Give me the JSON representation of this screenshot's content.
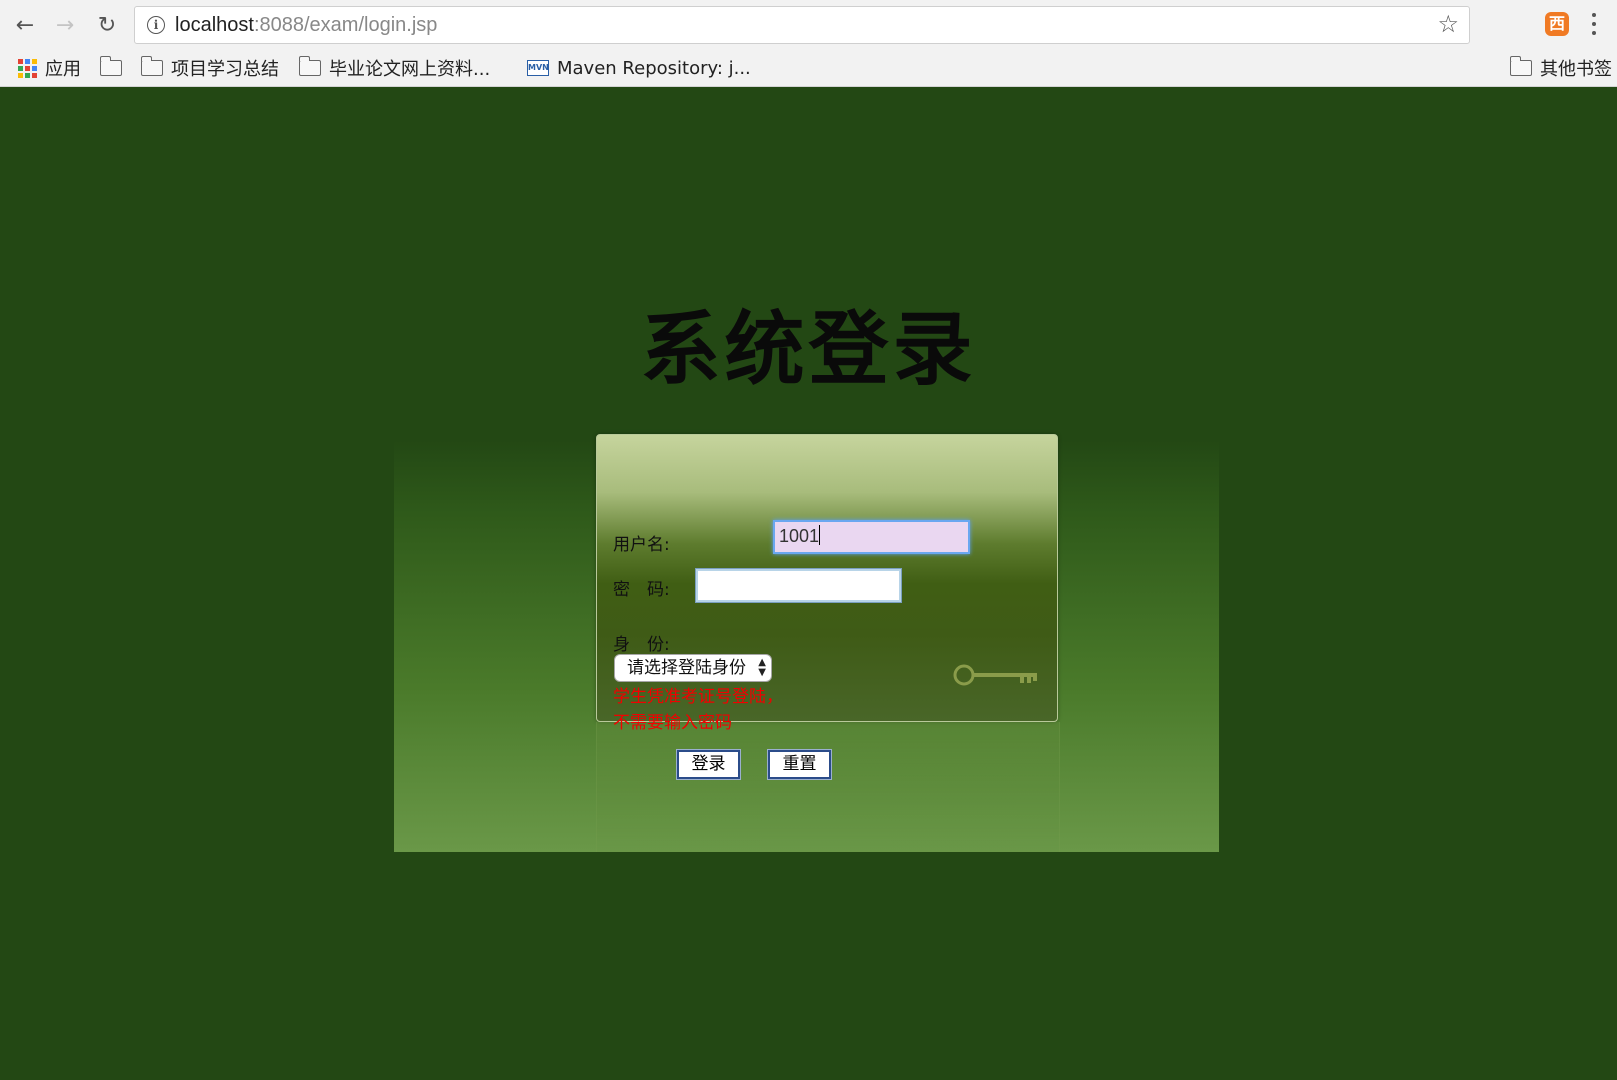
{
  "browser": {
    "url_host": "localhost",
    "url_path": ":8088/exam/login.jsp",
    "ext_icon_text": "西"
  },
  "bookmarks": {
    "apps_label": "应用",
    "folder1_label": "项目学习总结",
    "folder2_label": "毕业论文网上资料...",
    "maven_label": "Maven Repository: j...",
    "maven_icon_text": "MVN",
    "other_label": "其他书签"
  },
  "page": {
    "title": "系统登录",
    "username_label": "用户名:",
    "username_value": "1001",
    "password_label": "密　码:",
    "password_value": "",
    "role_label": "身　份:",
    "role_select_value": "请选择登陆身份",
    "warning_text": "学生凭准考证号登陆，不需要输入密码",
    "login_button": "登录",
    "reset_button": "重置"
  },
  "colors": {
    "page_background": "#234814",
    "warning": "#f20000",
    "input_focus_border": "#6aa7f0"
  },
  "icons": [
    "back-arrow-icon",
    "forward-arrow-icon",
    "reload-icon",
    "info-icon",
    "star-icon",
    "extension-icon",
    "menu-icon",
    "apps-icon",
    "folder-icon",
    "maven-icon",
    "key-icon"
  ]
}
